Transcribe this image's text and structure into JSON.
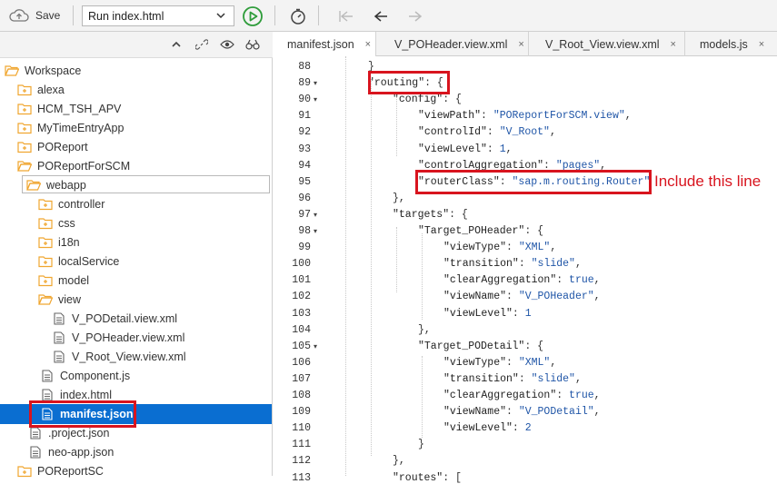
{
  "toolbar": {
    "save_label": "Save",
    "run_config": "Run index.html"
  },
  "tree": {
    "items": [
      {
        "label": "Workspace",
        "type": "folder-open",
        "level": 0
      },
      {
        "label": "alexa",
        "type": "folder",
        "level": 1
      },
      {
        "label": "HCM_TSH_APV",
        "type": "folder",
        "level": 1
      },
      {
        "label": "MyTimeEntryApp",
        "type": "folder",
        "level": 1
      },
      {
        "label": "POReport",
        "type": "folder",
        "level": 1
      },
      {
        "label": "POReportForSCM",
        "type": "folder-open",
        "level": 1
      },
      {
        "label": "webapp",
        "type": "folder-open",
        "level": 2
      },
      {
        "label": "controller",
        "type": "folder",
        "level": 3
      },
      {
        "label": "css",
        "type": "folder",
        "level": 3
      },
      {
        "label": "i18n",
        "type": "folder",
        "level": 3
      },
      {
        "label": "localService",
        "type": "folder",
        "level": 3
      },
      {
        "label": "model",
        "type": "folder",
        "level": 3
      },
      {
        "label": "view",
        "type": "folder-open",
        "level": 3
      },
      {
        "label": "V_PODetail.view.xml",
        "type": "file",
        "level": 4
      },
      {
        "label": "V_POHeader.view.xml",
        "type": "file",
        "level": 4
      },
      {
        "label": "V_Root_View.view.xml",
        "type": "file",
        "level": 4
      },
      {
        "label": "Component.js",
        "type": "file",
        "level": 3
      },
      {
        "label": "index.html",
        "type": "file",
        "level": 3
      },
      {
        "label": "manifest.json",
        "type": "file",
        "level": 3,
        "selected": true
      },
      {
        "label": ".project.json",
        "type": "file",
        "level": 2
      },
      {
        "label": "neo-app.json",
        "type": "file",
        "level": 2
      },
      {
        "label": "POReportSC",
        "type": "folder",
        "level": 1
      }
    ]
  },
  "tabs": [
    {
      "label": "manifest.json",
      "active": true
    },
    {
      "label": "V_POHeader.view.xml",
      "active": false
    },
    {
      "label": "V_Root_View.view.xml",
      "active": false
    },
    {
      "label": "models.js",
      "active": false
    }
  ],
  "tab_close_glyph": "×",
  "editor": {
    "lines": [
      {
        "num": "88",
        "fold": "",
        "text": "}"
      },
      {
        "num": "89",
        "fold": "▾",
        "text": "\"routing\": {"
      },
      {
        "num": "90",
        "fold": "▾",
        "text": "\"config\": {"
      },
      {
        "num": "91",
        "fold": "",
        "text": "\"viewPath\": \"POReportForSCM.view\","
      },
      {
        "num": "92",
        "fold": "",
        "text": "\"controlId\": \"V_Root\","
      },
      {
        "num": "93",
        "fold": "",
        "text": "\"viewLevel\": 1,"
      },
      {
        "num": "94",
        "fold": "",
        "text": "\"controlAggregation\": \"pages\","
      },
      {
        "num": "95",
        "fold": "",
        "text": "\"routerClass\": \"sap.m.routing.Router\""
      },
      {
        "num": "96",
        "fold": "",
        "text": "},"
      },
      {
        "num": "97",
        "fold": "▾",
        "text": "\"targets\": {"
      },
      {
        "num": "98",
        "fold": "▾",
        "text": "\"Target_POHeader\": {"
      },
      {
        "num": "99",
        "fold": "",
        "text": "\"viewType\": \"XML\","
      },
      {
        "num": "100",
        "fold": "",
        "text": "\"transition\": \"slide\","
      },
      {
        "num": "101",
        "fold": "",
        "text": "\"clearAggregation\": true,"
      },
      {
        "num": "102",
        "fold": "",
        "text": "\"viewName\": \"V_POHeader\","
      },
      {
        "num": "103",
        "fold": "",
        "text": "\"viewLevel\": 1"
      },
      {
        "num": "104",
        "fold": "",
        "text": "},"
      },
      {
        "num": "105",
        "fold": "▾",
        "text": "\"Target_PODetail\": {"
      },
      {
        "num": "106",
        "fold": "",
        "text": "\"viewType\": \"XML\","
      },
      {
        "num": "107",
        "fold": "",
        "text": "\"transition\": \"slide\","
      },
      {
        "num": "108",
        "fold": "",
        "text": "\"clearAggregation\": true,"
      },
      {
        "num": "109",
        "fold": "",
        "text": "\"viewName\": \"V_PODetail\","
      },
      {
        "num": "110",
        "fold": "",
        "text": "\"viewLevel\": 2"
      },
      {
        "num": "111",
        "fold": "",
        "text": "}"
      },
      {
        "num": "112",
        "fold": "",
        "text": "},"
      },
      {
        "num": "113",
        "fold": "",
        "text": "\"routes\": ["
      }
    ]
  },
  "annotation": {
    "text": "Include this line"
  },
  "colors": {
    "selection": "#0a6ed1",
    "highlight_box": "#d8141e",
    "folder": "#f0a630",
    "string": "#1f55a7",
    "run_button": "#2e9c3a"
  }
}
